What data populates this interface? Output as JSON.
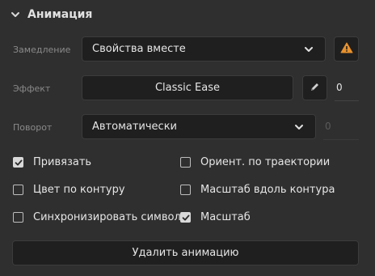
{
  "section": {
    "title": "Анимация"
  },
  "easing": {
    "label": "Замедление",
    "value": "Свойства вместе"
  },
  "effect": {
    "label": "Эффект",
    "value": "Classic Ease",
    "number": "0"
  },
  "rotation": {
    "label": "Поворот",
    "value": "Автоматически",
    "number": "0"
  },
  "checkboxes": {
    "snap": {
      "label": "Привязать",
      "checked": true
    },
    "orient": {
      "label": "Ориент. по траектории",
      "checked": false
    },
    "color_path": {
      "label": "Цвет по контуру",
      "checked": false
    },
    "scale_path": {
      "label": "Масштаб вдоль контура",
      "checked": false
    },
    "sync": {
      "label": "Синхронизировать символы",
      "checked": false
    },
    "scale": {
      "label": "Масштаб",
      "checked": true
    }
  },
  "delete_button": {
    "label": "Удалить анимацию"
  },
  "colors": {
    "warning": "#e8912d",
    "panel_bg": "#2f2f2f",
    "field_bg": "#1f1f1f"
  },
  "icons": [
    "chevron-down-icon",
    "warning-icon",
    "pencil-icon",
    "dropdown-caret-icon",
    "checkmark-icon"
  ]
}
